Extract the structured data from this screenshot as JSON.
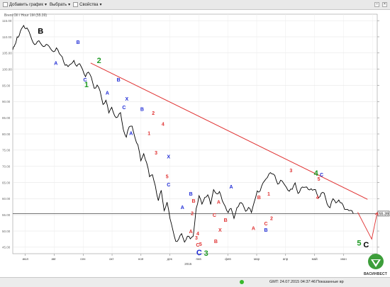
{
  "toolbar": {
    "add_chart": "Добавить график",
    "choose": "Выбрать",
    "properties": "Свойства"
  },
  "chart_data": {
    "type": "line",
    "series_label": "Brent Oil / Hour 1M (55.39)",
    "current_price": "55.39",
    "y_ticks": [
      "115.00",
      "110.00",
      "105.00",
      "100.00",
      "95.00",
      "90.00",
      "85.00",
      "80.00",
      "75.00",
      "70.00",
      "65.00",
      "60.00",
      "55.00",
      "50.00",
      "45.00"
    ],
    "ylim": [
      43,
      117
    ],
    "x_months": [
      "июл",
      "авг",
      "сен",
      "окт",
      "ноя",
      "дек",
      "янв",
      "фев",
      "мар",
      "апр",
      "май",
      "июн",
      "июл"
    ],
    "x_year": "2015",
    "x": [
      0,
      2,
      4,
      6,
      9,
      12,
      15,
      18,
      21,
      24,
      28,
      32,
      36,
      40,
      44,
      48,
      52,
      56,
      60,
      64,
      68,
      72,
      76,
      80,
      84,
      88,
      92,
      96,
      100,
      104,
      108,
      112,
      116,
      120,
      124,
      128,
      132,
      136,
      140,
      144,
      148,
      152,
      156,
      160,
      164,
      168,
      172,
      176,
      180,
      184,
      188,
      192,
      196,
      200,
      204,
      208,
      212,
      216,
      220,
      224,
      228,
      232,
      236,
      240,
      244,
      248,
      252,
      256,
      260,
      264,
      268,
      272,
      276,
      280,
      284,
      288,
      292,
      296,
      300,
      304,
      308,
      312,
      316,
      320,
      324,
      328,
      332,
      336,
      340,
      344,
      348,
      352,
      356,
      360,
      364,
      368,
      372,
      376,
      380,
      384,
      388,
      392,
      396,
      400,
      404,
      408,
      412,
      416,
      420,
      424,
      428,
      432,
      436,
      440,
      444,
      448,
      452,
      456,
      460,
      464,
      468,
      472,
      476
    ],
    "values": [
      106,
      107,
      108,
      110,
      110.5,
      112.5,
      113.5,
      112.5,
      112.2,
      110.6,
      108.2,
      107.8,
      108.8,
      107.4,
      107.1,
      107.5,
      106.3,
      105.4,
      106.6,
      104.8,
      103.8,
      101.2,
      100.8,
      101.6,
      102.7,
      100.9,
      101.7,
      99.9,
      97.7,
      99.1,
      97.5,
      94.1,
      95.1,
      93.2,
      89.1,
      90.4,
      86.5,
      88.2,
      85.6,
      85.2,
      86.6,
      81.3,
      79,
      82.2,
      82.4,
      78.8,
      76.6,
      71.7,
      73.9,
      71.1,
      66.8,
      67.4,
      63.9,
      59.4,
      62.6,
      56.3,
      58.9,
      53.9,
      50.3,
      46.8,
      47.5,
      49.2,
      46.6,
      48.4,
      47.6,
      48.4,
      56.9,
      60.9,
      58.3,
      60.4,
      61.2,
      58.2,
      62.8,
      61.5,
      62.2,
      59.3,
      57.6,
      55.7,
      57,
      53.9,
      57.2,
      58.7,
      58.3,
      56.1,
      57.3,
      55.7,
      59.1,
      62.4,
      62.4,
      64.9,
      66.1,
      67.6,
      67.7,
      67.2,
      64.5,
      65.7,
      64.8,
      63.5,
      62.3,
      62.9,
      64.9,
      61.6,
      63.2,
      63.5,
      63.6,
      62.7,
      62.6,
      62.8,
      60.3,
      61.7,
      61.7,
      58.4,
      57.2,
      60,
      58.7,
      59.6,
      58.7,
      56.7,
      56.7,
      56.4,
      55.4
    ],
    "trendline": [
      [
        56,
        101.9
      ],
      [
        255,
        59.8
      ]
    ],
    "forecast": [
      [
        248,
        55.8
      ],
      [
        258,
        47.5
      ],
      [
        262,
        55.7
      ]
    ],
    "wave_labels": [
      {
        "text": "B",
        "x": 20,
        "y": 111,
        "color": "#000000",
        "big": true
      },
      {
        "text": "A",
        "x": 31,
        "y": 101.3,
        "color": "#1e2bd6"
      },
      {
        "text": "B",
        "x": 47,
        "y": 107.8,
        "color": "#1e2bd6"
      },
      {
        "text": "C",
        "x": 52,
        "y": 96.2,
        "color": "#1e2bd6"
      },
      {
        "text": "1",
        "x": 53,
        "y": 94.4,
        "color": "#1f9a24",
        "big": true
      },
      {
        "text": "2",
        "x": 62,
        "y": 101.9,
        "color": "#1f9a24",
        "big": true
      },
      {
        "text": "A",
        "x": 68,
        "y": 92.2,
        "color": "#1e2bd6"
      },
      {
        "text": "B",
        "x": 76,
        "y": 96.2,
        "color": "#1e2bd6"
      },
      {
        "text": "X",
        "x": 82,
        "y": 90.3,
        "color": "#1e2bd6"
      },
      {
        "text": "C",
        "x": 80,
        "y": 87.7,
        "color": "#1e2bd6"
      },
      {
        "text": "A",
        "x": 85,
        "y": 79.7,
        "color": "#1e2bd6"
      },
      {
        "text": "B",
        "x": 93,
        "y": 87.1,
        "color": "#1e2bd6"
      },
      {
        "text": "2",
        "x": 101,
        "y": 85.9,
        "color": "#e03131"
      },
      {
        "text": "1",
        "x": 98,
        "y": 79.7,
        "color": "#e03131"
      },
      {
        "text": "4",
        "x": 108,
        "y": 82.5,
        "color": "#e03131"
      },
      {
        "text": "3",
        "x": 103,
        "y": 73.7,
        "color": "#e03131"
      },
      {
        "text": "X",
        "x": 112,
        "y": 72.4,
        "color": "#1e2bd6"
      },
      {
        "text": "5",
        "x": 111,
        "y": 66.3,
        "color": "#e03131"
      },
      {
        "text": "C",
        "x": 112,
        "y": 63.8,
        "color": "#1e2bd6"
      },
      {
        "text": "A",
        "x": 122,
        "y": 56.8,
        "color": "#1e2bd6"
      },
      {
        "text": "B",
        "x": 128,
        "y": 60.9,
        "color": "#1e2bd6"
      },
      {
        "text": "B",
        "x": 130,
        "y": 58.8,
        "color": "#e03131"
      },
      {
        "text": "2",
        "x": 129,
        "y": 54.9,
        "color": "#e03131"
      },
      {
        "text": "A",
        "x": 128,
        "y": 49.3,
        "color": "#e03131"
      },
      {
        "text": "4",
        "x": 133,
        "y": 48.7,
        "color": "#e03131"
      },
      {
        "text": "3",
        "x": 132,
        "y": 47.4,
        "color": "#e03131"
      },
      {
        "text": "C",
        "x": 133,
        "y": 45.2,
        "color": "#e03131"
      },
      {
        "text": "5",
        "x": 135,
        "y": 45.4,
        "color": "#e03131"
      },
      {
        "text": "C",
        "x": 134,
        "y": 42.6,
        "color": "#1e2bd6",
        "big": true
      },
      {
        "text": "3",
        "x": 139,
        "y": 42.3,
        "color": "#1f9a24",
        "big": true
      },
      {
        "text": "B",
        "x": 146,
        "y": 46.3,
        "color": "#e03131"
      },
      {
        "text": "C",
        "x": 145,
        "y": 54.4,
        "color": "#e03131"
      },
      {
        "text": "A",
        "x": 148,
        "y": 58.4,
        "color": "#e03131"
      },
      {
        "text": "X",
        "x": 149,
        "y": 49.8,
        "color": "#e03131"
      },
      {
        "text": "B",
        "x": 153,
        "y": 52.9,
        "color": "#e03131"
      },
      {
        "text": "A",
        "x": 157,
        "y": 63.1,
        "color": "#1e2bd6"
      },
      {
        "text": "A",
        "x": 173,
        "y": 50.3,
        "color": "#e03131"
      },
      {
        "text": "B",
        "x": 177,
        "y": 59.9,
        "color": "#e03131"
      },
      {
        "text": "1",
        "x": 184,
        "y": 60.9,
        "color": "#e03131"
      },
      {
        "text": "C",
        "x": 182,
        "y": 51.8,
        "color": "#e03131"
      },
      {
        "text": "B",
        "x": 182,
        "y": 49.8,
        "color": "#1e2bd6"
      },
      {
        "text": "2",
        "x": 186,
        "y": 53.4,
        "color": "#e03131"
      },
      {
        "text": "3",
        "x": 200,
        "y": 68.2,
        "color": "#e03131"
      },
      {
        "text": "4",
        "x": 218,
        "y": 67.1,
        "color": "#1f9a24",
        "big": true
      },
      {
        "text": "C",
        "x": 222,
        "y": 66.9,
        "color": "#1e2bd6"
      },
      {
        "text": "5",
        "x": 220,
        "y": 65.6,
        "color": "#e03131"
      },
      {
        "text": "4",
        "x": 219,
        "y": 59.9,
        "color": "#e03131"
      },
      {
        "text": "5",
        "x": 249,
        "y": 45.5,
        "color": "#1f9a24",
        "big": true
      },
      {
        "text": "C",
        "x": 254,
        "y": 45.0,
        "color": "#000000",
        "big": true
      }
    ]
  },
  "logo": {
    "name": "ВАСИНВЕСТ"
  },
  "status": {
    "time": "GMT: 24.07.2015 04:37:46",
    "summary": "Показанные вр"
  }
}
